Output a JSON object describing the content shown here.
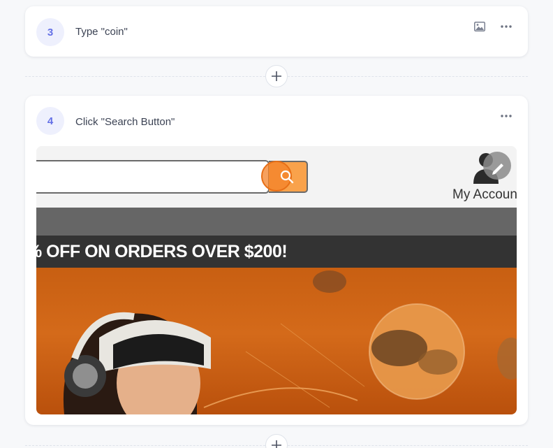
{
  "steps": [
    {
      "number": "3",
      "label": "Type \"coin\""
    },
    {
      "number": "4",
      "label": "Click \"Search Button\""
    }
  ],
  "screenshot": {
    "account_label": "My Accoun",
    "promo_text": "% OFF ON ORDERS OVER $200!"
  },
  "colors": {
    "accent": "#6470e6",
    "search_button": "#f9a24b",
    "promo_band": "#333333",
    "hero": "#c85f12"
  },
  "icons": [
    "image-icon",
    "more-options-icon",
    "add-step-icon",
    "search-icon",
    "user-icon",
    "edit-icon"
  ]
}
